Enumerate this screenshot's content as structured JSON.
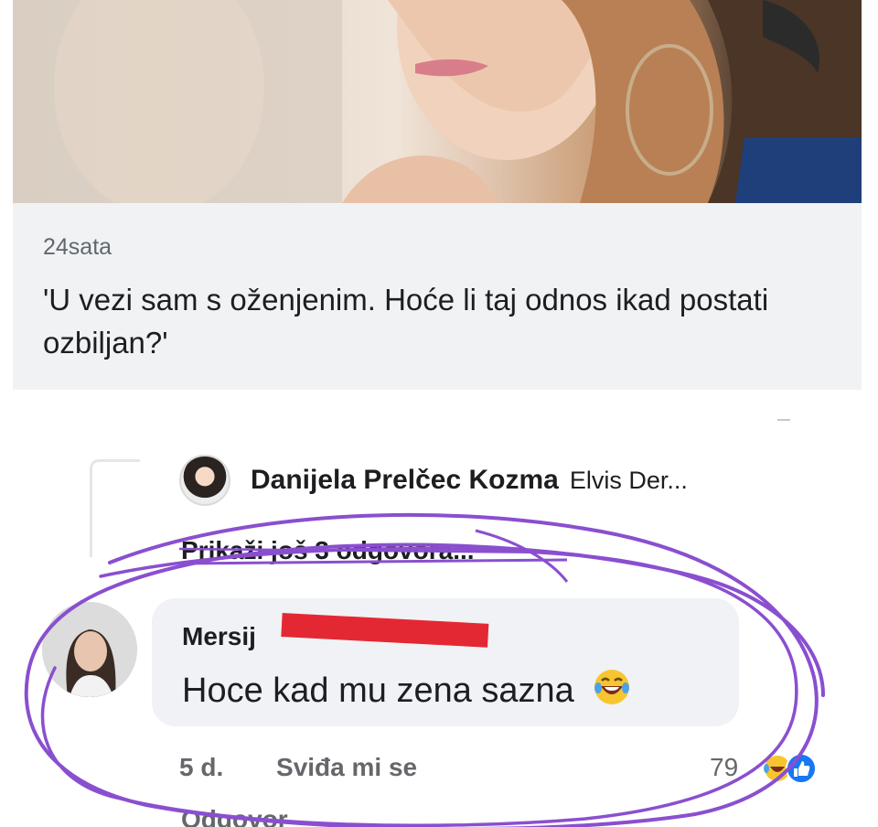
{
  "link_preview": {
    "source": "24sata",
    "headline": "'U vezi sam s oženjenim. Hoće li taj odnos ikad postati ozbiljan?'"
  },
  "reply_preview": {
    "name": "Danijela Prelčec Kozma",
    "tagged": "Elvis Der..."
  },
  "more_replies": "Prikaži još 3 odgovora...",
  "comment": {
    "author_visible": "Mersij",
    "text": "Hoce kad mu zena sazna",
    "emoji": "laughing-tears-icon",
    "time": "5 d.",
    "like_label": "Sviđa mi se",
    "reply_label": "Odgovor",
    "reaction_count": "79"
  },
  "colors": {
    "annotation": "#8a4fcf",
    "redaction": "#e42833",
    "like_blue": "#1877f2"
  }
}
